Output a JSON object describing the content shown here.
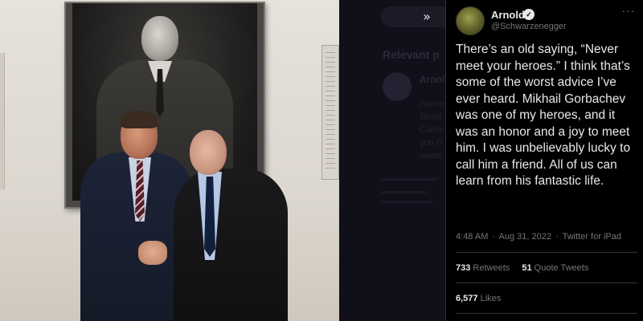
{
  "overlay": {
    "expand_icon_glyph": "»",
    "dim_heading": "Relevant p",
    "dim_name": "Arnold",
    "dim_lines": [
      "Forme",
      "Termi",
      "Califo",
      "you I'l",
      "newsl"
    ]
  },
  "tweet": {
    "display_name": "Arnold",
    "handle": "@Schwarzenegger",
    "verified_glyph": "✓",
    "more_glyph": "···",
    "text": "There’s an old saying, “Never meet your heroes.” I think that’s some of the worst advice I’ve ever heard. Mikhail Gorbachev was one of my heroes, and it was an honor and a joy to meet him. I was unbelievably lucky to call him a friend. All of us can learn from his fantastic life.",
    "time": "4:48 AM",
    "date": "Aug 31, 2022",
    "source": "Twitter for iPad",
    "separator": "·",
    "retweets_count": "733",
    "retweets_label": "Retweets",
    "quote_count": "51",
    "quote_label": "Quote Tweets",
    "likes_count": "6,577",
    "likes_label": "Likes"
  },
  "colors": {
    "panel_bg": "#000000",
    "text_primary": "#e7e9ea",
    "text_secondary": "#71767b",
    "divider": "#2f3336"
  }
}
